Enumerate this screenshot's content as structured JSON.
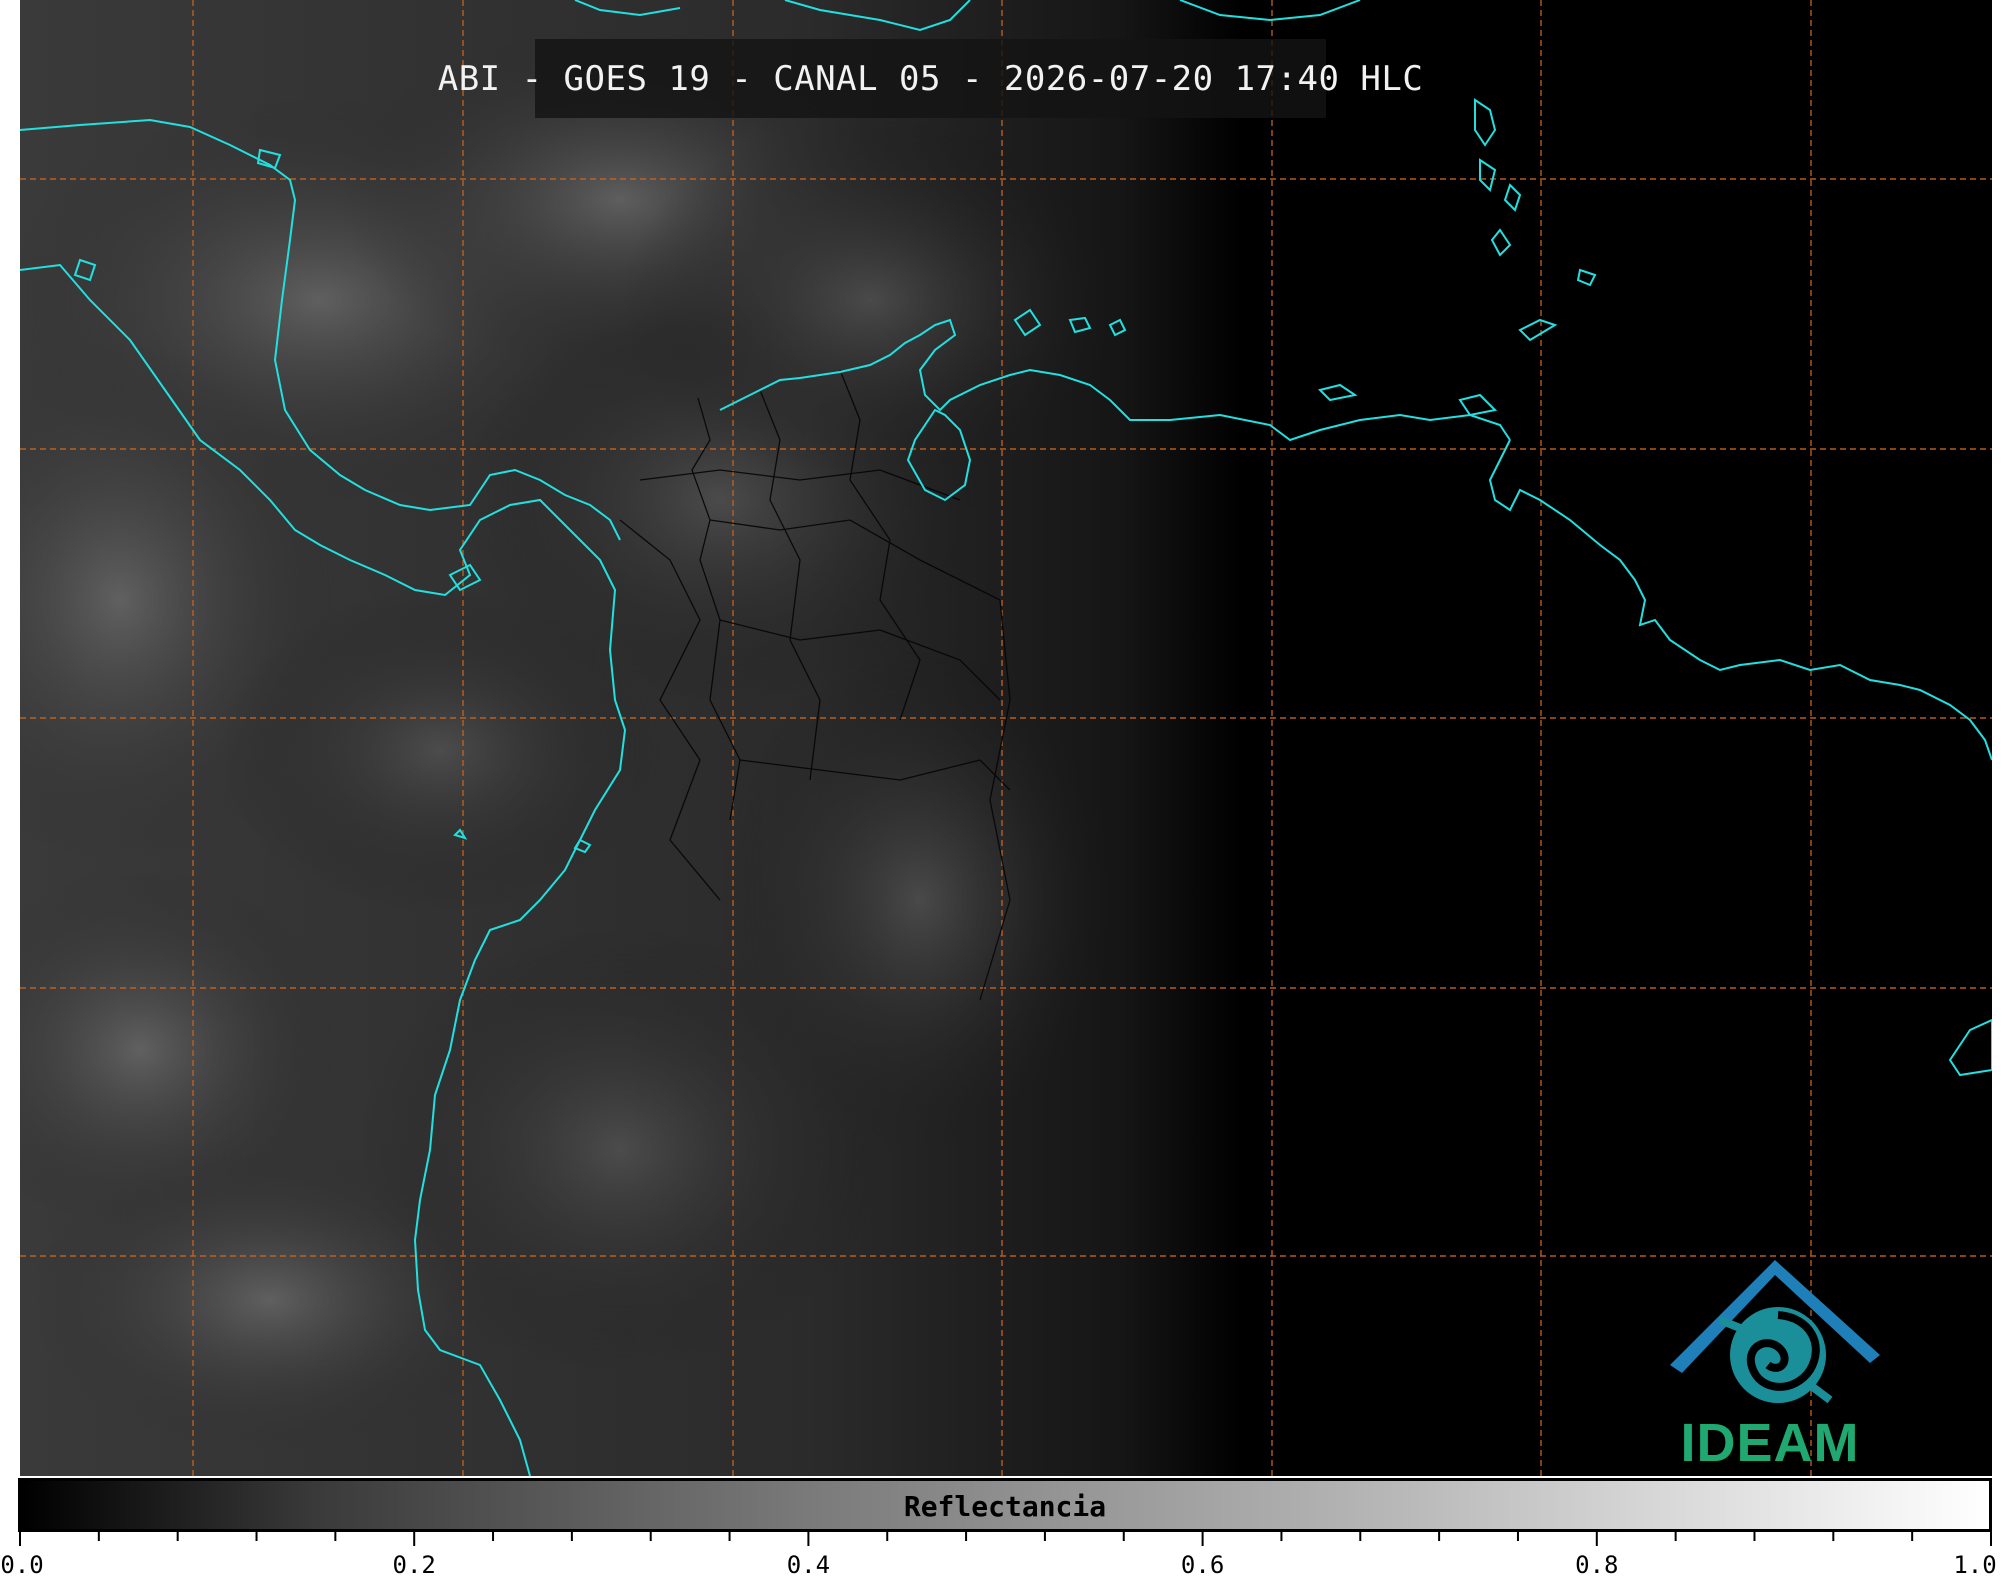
{
  "title": "ABI - GOES 19 - CANAL 05 - 2026-07-20 17:40 HLC",
  "logo": {
    "text": "IDEAM",
    "icon": "ideam-logo-icon"
  },
  "colors": {
    "coastline": "#22e0e0",
    "graticule": "#c8641e",
    "logo_blue": "#1f7fb8",
    "logo_green": "#1fa86f"
  },
  "colorbar": {
    "label": "Reflectancia",
    "ticks": [
      "0.0",
      "0.2",
      "0.4",
      "0.6",
      "0.8",
      "1.0"
    ],
    "range": [
      0.0,
      1.0
    ],
    "colormap": "grayscale"
  }
}
